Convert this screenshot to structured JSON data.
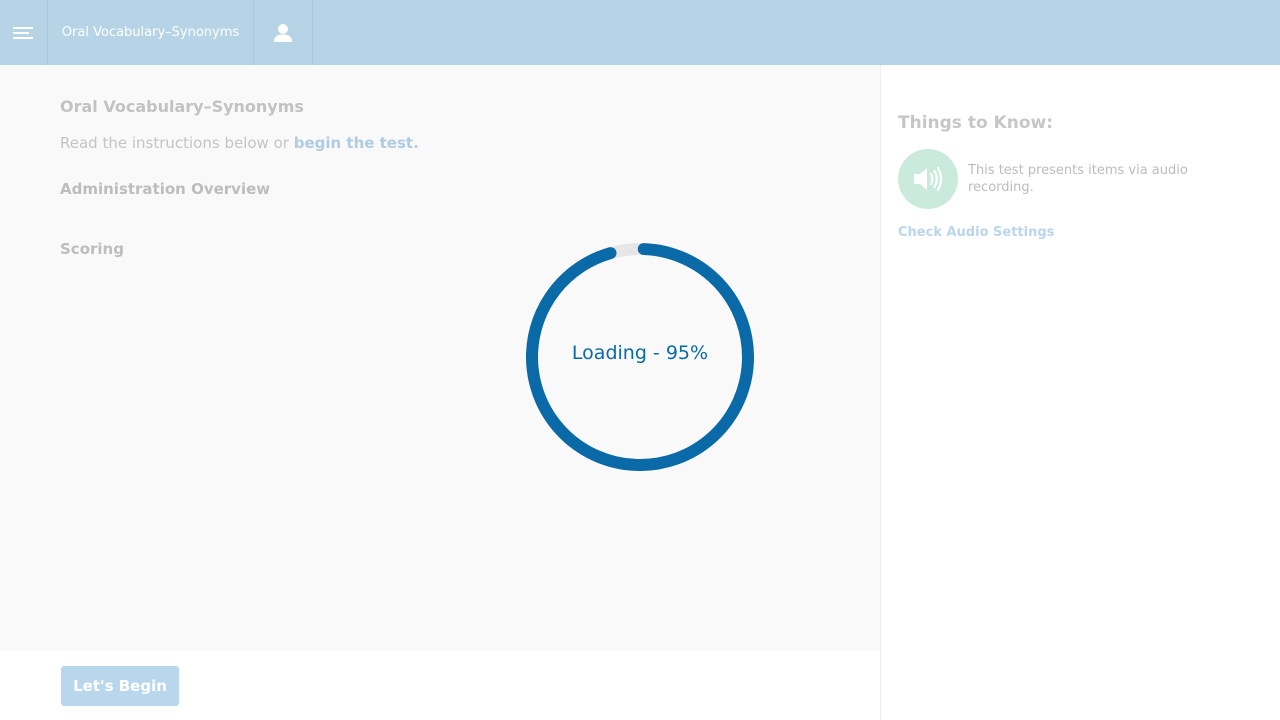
{
  "header": {
    "title": "Oral Vocabulary–Synonyms",
    "menu_icon": "hamburger-menu-icon",
    "user_icon": "user-icon"
  },
  "main": {
    "page_title": "Oral Vocabulary–Synonyms",
    "instructions_prefix": "Read the instructions below or ",
    "instructions_link": "begin the test.",
    "sections": [
      "Administration Overview",
      "Scoring"
    ]
  },
  "loader": {
    "text": "Loading - 95%",
    "progress": 0.95,
    "color": "#0a6aa8",
    "track_color": "#e6e6e6"
  },
  "footer": {
    "begin_label": "Let's Begin"
  },
  "aside": {
    "title": "Things to Know:",
    "audio_icon": "speaker-icon",
    "audio_text": "This test presents items via audio recording.",
    "audio_link": "Check Audio Settings"
  },
  "colors": {
    "header_bg": "#b7d4e6",
    "accent": "#0a6aa8",
    "audio_circle": "#c9eadc"
  }
}
